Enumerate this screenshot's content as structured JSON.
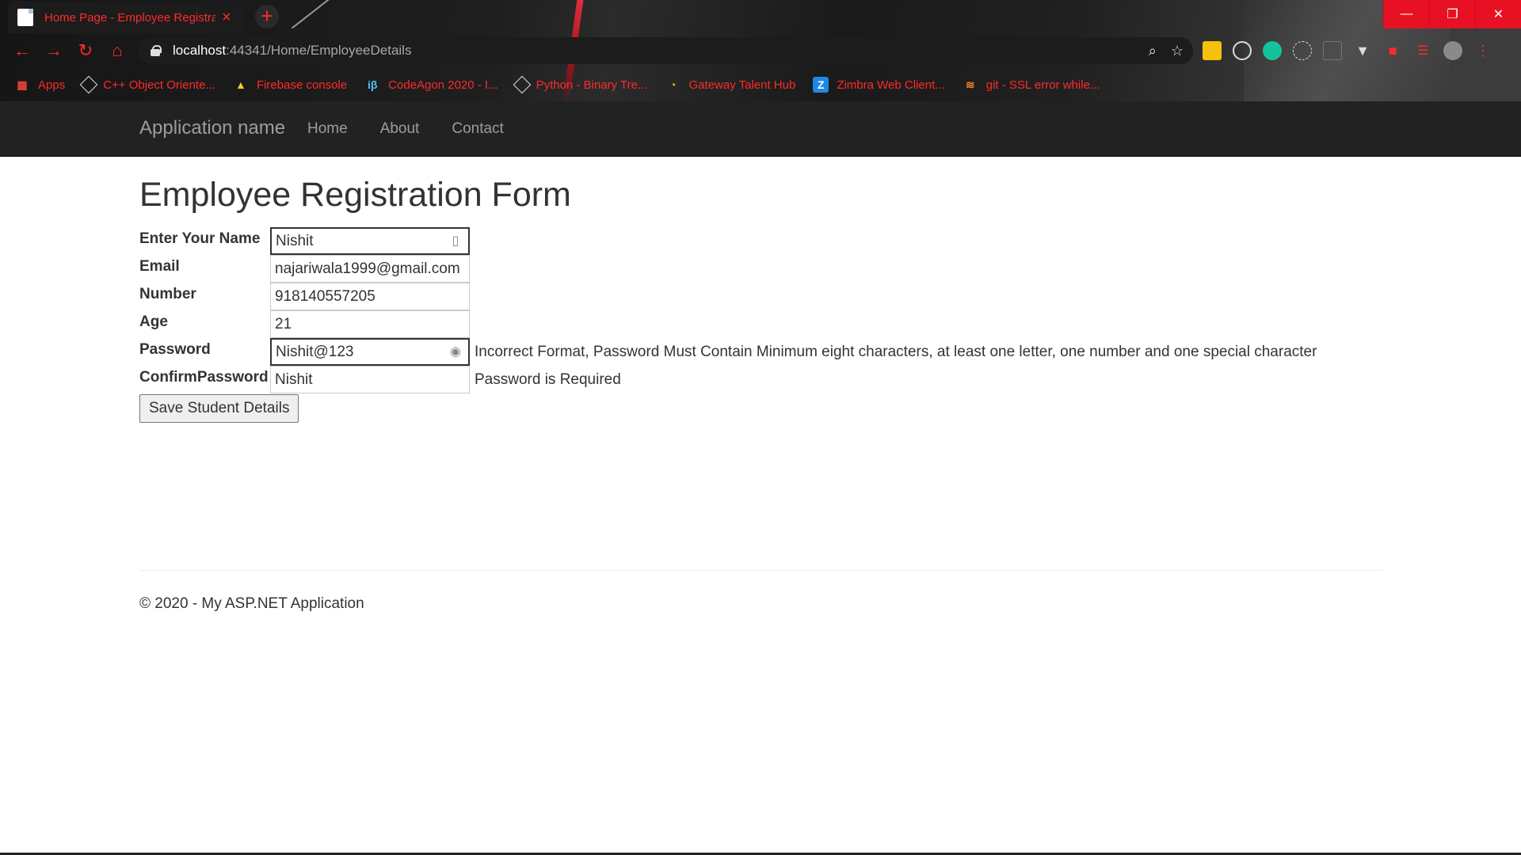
{
  "browser": {
    "tab_title": "Home Page - Employee Registration",
    "tab_close": "×",
    "new_tab": "+",
    "url_host": "localhost",
    "url_path": ":44341/Home/EmployeeDetails",
    "window_buttons": {
      "minimize": "—",
      "restore": "❐",
      "close": "✕"
    },
    "nav": {
      "back": "←",
      "forward": "→",
      "reload": "↻",
      "home": "⌂"
    },
    "omnibox_icons": {
      "zoom": "⌕",
      "bookmark": "☆"
    },
    "bookmarks": [
      {
        "label": "Apps",
        "icon": "apps-grid-icon",
        "color": "#ea4335"
      },
      {
        "label": "C++ Object Oriente...",
        "icon": "hackerrank-icon",
        "color": "#ffffff"
      },
      {
        "label": "Firebase console",
        "icon": "firebase-icon",
        "color": "#ffca28"
      },
      {
        "label": "CodeAgon 2020 - I...",
        "icon": "interviewbit-icon",
        "color": "#4fc3f7"
      },
      {
        "label": "Python - Binary Tre...",
        "icon": "hackerrank-icon",
        "color": "#ffffff"
      },
      {
        "label": "Gateway Talent Hub",
        "icon": "gateway-icon",
        "color": "#f2b705"
      },
      {
        "label": "Zimbra Web Client...",
        "icon": "zimbra-icon",
        "color": "#1e88e5"
      },
      {
        "label": "git - SSL error while...",
        "icon": "stackoverflow-icon",
        "color": "#f48024"
      }
    ],
    "accent_color": "#ff2a2a"
  },
  "navbar": {
    "brand": "Application name",
    "links": [
      "Home",
      "About",
      "Contact"
    ]
  },
  "form": {
    "title": "Employee Registration Form",
    "fields": [
      {
        "label": "Enter Your Name",
        "value": "Nishit",
        "message": ""
      },
      {
        "label": "Email",
        "value": "najariwala1999@gmail.com",
        "message": ""
      },
      {
        "label": "Number",
        "value": "918140557205",
        "message": ""
      },
      {
        "label": "Age",
        "value": "21",
        "message": ""
      },
      {
        "label": "Password",
        "value": "Nishit@123",
        "message": "Incorrect Format, Password Must Contain Minimum eight characters, at least one letter, one number and one special character"
      },
      {
        "label": "ConfirmPassword",
        "value": "Nishit",
        "message": "Password is Required"
      }
    ],
    "submit_label": "Save Student Details"
  },
  "footer": {
    "text": "© 2020 - My ASP.NET Application"
  }
}
